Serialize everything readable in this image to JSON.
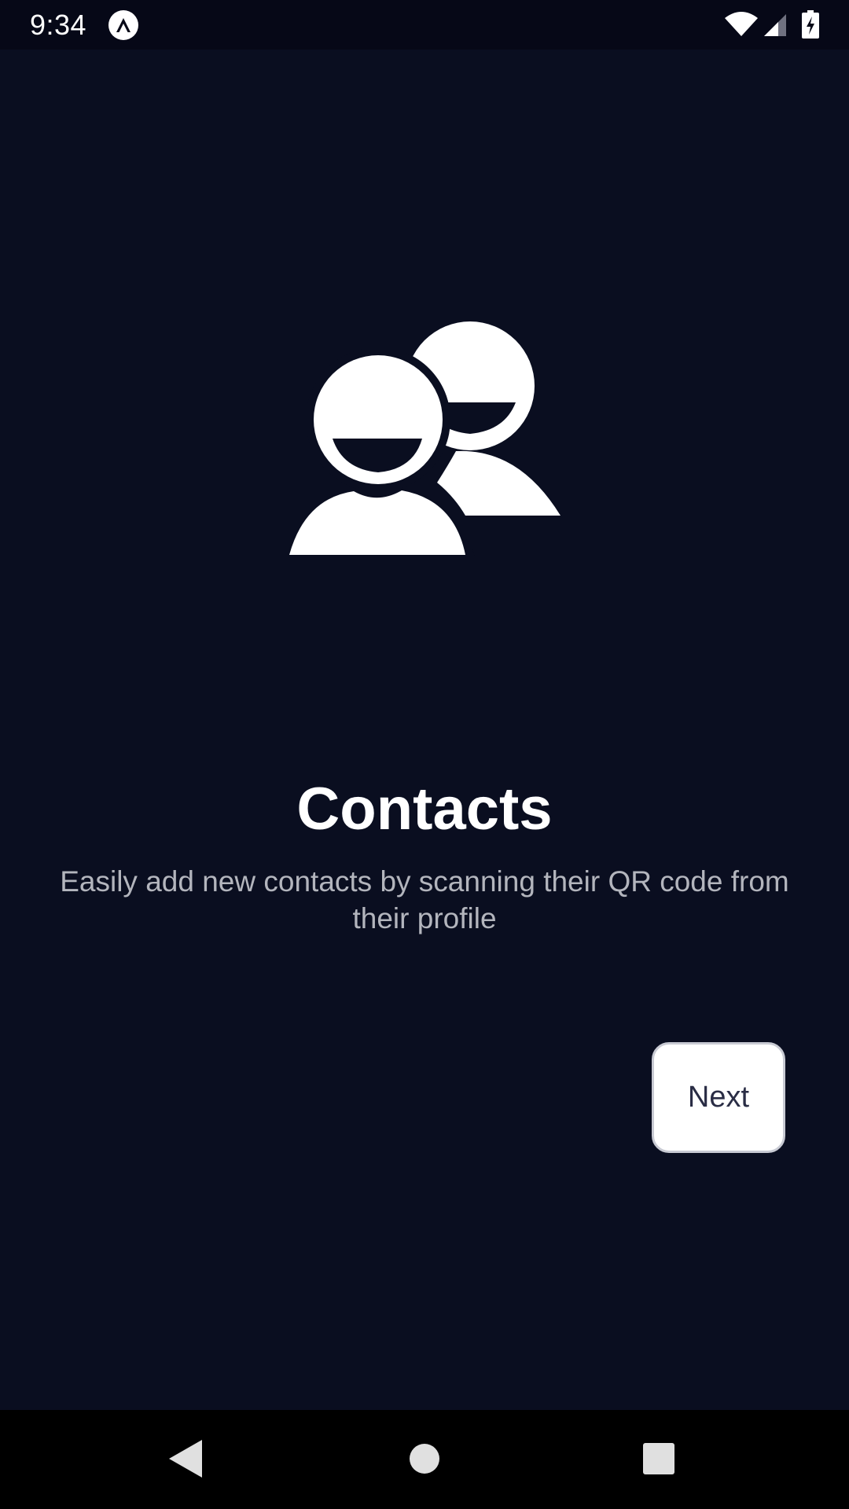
{
  "status_bar": {
    "time": "9:34"
  },
  "onboarding": {
    "hero_icon": "contacts-people-icon",
    "title": "Contacts",
    "description": "Easily add new contacts by scanning their QR code from their profile",
    "next_label": "Next"
  },
  "nav_bar": {
    "back_icon": "back-triangle-icon",
    "home_icon": "home-circle-icon",
    "recents_icon": "recents-square-icon"
  },
  "colors": {
    "background": "#0a0e20",
    "status_bar_bg": "#060817",
    "title": "#ffffff",
    "subtitle": "#b3b5bd",
    "button_bg": "#ffffff",
    "button_text": "#2a2d45"
  }
}
